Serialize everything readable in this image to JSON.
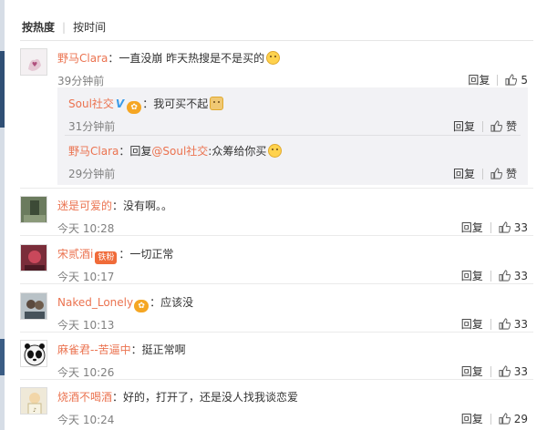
{
  "sort": {
    "hot": "按热度",
    "time": "按时间"
  },
  "comments": [
    {
      "user": "野马Clara",
      "text": "：一直没崩 昨天热搜是不是买的",
      "time": "39分钟前",
      "reply_label": "回复",
      "likes": "5"
    },
    {
      "user": "迷是可爱的",
      "text": "：没有啊。。",
      "time": "今天 10:28",
      "reply_label": "回复",
      "likes": "33"
    },
    {
      "user": "宋贰酒i",
      "badge": "铁粉",
      "text": "：一切正常",
      "time": "今天 10:17",
      "reply_label": "回复",
      "likes": "33"
    },
    {
      "user": "Naked_Lonely",
      "text": "：应该没",
      "time": "今天 10:13",
      "reply_label": "回复",
      "likes": "33"
    },
    {
      "user": "麻雀君--苦逼中",
      "text": "：挺正常啊",
      "time": "今天 10:26",
      "reply_label": "回复",
      "likes": "33"
    },
    {
      "user": "烧酒不喝酒",
      "text": "：好的，打开了，还是没人找我谈恋爱",
      "time": "今天 10:24",
      "reply_label": "回复",
      "likes": "29"
    }
  ],
  "replies": [
    {
      "user": "Soul社交",
      "text": "：我可买不起",
      "time": "31分钟前",
      "reply_label": "回复",
      "like_label": "赞"
    },
    {
      "user": "野马Clara",
      "text_prefix": "：回复",
      "mention": "@Soul社交",
      "text": ":众筹给你买",
      "time": "29分钟前",
      "reply_label": "回复",
      "like_label": "赞"
    }
  ],
  "colors": {
    "username": "#eb7350",
    "reply_bg": "#f2f2f5",
    "verified": "#3b9be8"
  }
}
